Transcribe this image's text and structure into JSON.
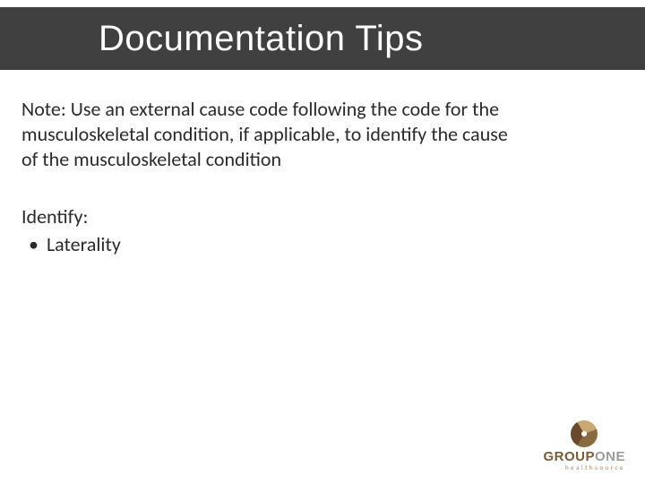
{
  "title": "Documentation Tips",
  "note": "Note: Use an external cause code following the code for the musculoskeletal condition, if applicable, to identify the cause of the musculoskeletal condition",
  "identify_label": "Identify:",
  "bullets": [
    "Laterality"
  ],
  "logo": {
    "word1": "GROUP",
    "word2": "ONE",
    "sub": "healthsource"
  }
}
